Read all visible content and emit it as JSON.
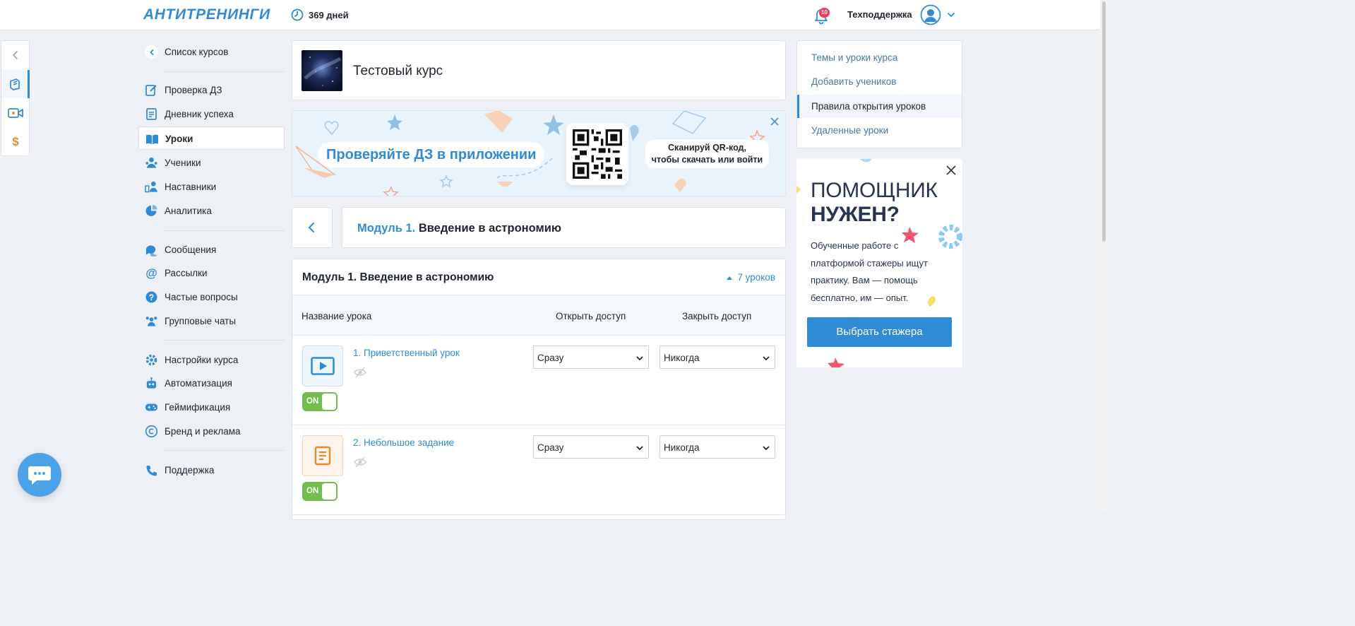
{
  "header": {
    "logo": "АНТИТРЕНИНГИ",
    "days": "369 дней",
    "notifications_count": "10",
    "user_name": "Техподдержка",
    "icons": [
      "clock-icon",
      "bell-icon",
      "avatar-icon",
      "chevron-down-icon"
    ]
  },
  "rail": {
    "items": [
      "collapse-arrow",
      "courses",
      "video",
      "money"
    ],
    "active": "courses"
  },
  "sidebar": {
    "back": "Список курсов",
    "group1": [
      "Проверка ДЗ",
      "Дневник успеха",
      "Уроки",
      "Ученики",
      "Наставники",
      "Аналитика"
    ],
    "group2": [
      "Сообщения",
      "Рассылки",
      "Частые вопросы",
      "Групповые чаты"
    ],
    "group3": [
      "Настройки курса",
      "Автоматизация",
      "Геймификация",
      "Бренд и реклама"
    ],
    "group4": [
      "Поддержка"
    ],
    "active": "Уроки"
  },
  "course": {
    "title": "Тестовый курс"
  },
  "banner": {
    "headline": "Проверяйте ДЗ в приложении",
    "qr_line1": "Сканируй QR-код,",
    "qr_line2": "чтобы скачать или войти"
  },
  "module": {
    "prefix": "Модуль 1.",
    "name": "Введение в астрономию",
    "block_title": "Модуль 1. Введение в астрономию",
    "lesson_count": "7 уроков"
  },
  "table": {
    "col_name": "Название урока",
    "col_open": "Открыть доступ",
    "col_close": "Закрыть доступ"
  },
  "lessons": [
    {
      "title": "1. Приветственный урок",
      "type": "video",
      "toggle": "ON",
      "open": "Сразу",
      "close": "Никогда"
    },
    {
      "title": "2. Небольшое задание",
      "type": "task",
      "toggle": "ON",
      "open": "Сразу",
      "close": "Никогда"
    }
  ],
  "right_nav": {
    "items": [
      "Темы и уроки курса",
      "Добавить учеников",
      "Правила открытия уроков",
      "Удаленные уроки"
    ],
    "active": "Правила открытия уроков"
  },
  "promo": {
    "title1": "ПОМОЩНИК",
    "title2": "НУЖЕН?",
    "body": "Обученные работе с платформой стажеры ищут практику. Вам — помощь бесплатно, им — опыт.",
    "button": "Выбрать стажера"
  },
  "colors": {
    "accent": "#2f8bd6",
    "toggle_on": "#72bd4d",
    "badge": "#ef3e5b",
    "task_icon": "#e7892e"
  }
}
